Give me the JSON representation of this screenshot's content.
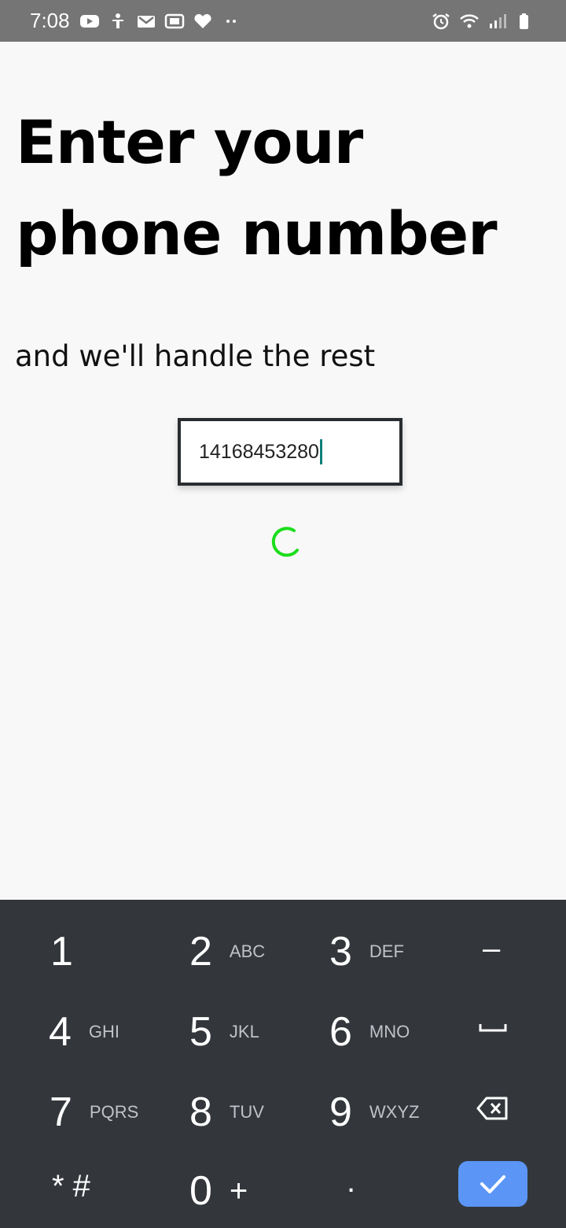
{
  "status_bar": {
    "time": "7:08",
    "left_icons": [
      "youtube-icon",
      "accessibility-icon",
      "gmail-icon",
      "app-icon",
      "heart-icon",
      "more-dots-icon"
    ],
    "right_icons": [
      "alarm-icon",
      "wifi-icon",
      "signal-icon",
      "battery-icon"
    ]
  },
  "main": {
    "title": "Enter your phone number",
    "subtitle": "and we'll handle the rest",
    "phone_input": {
      "value": "14168453280"
    },
    "spinner_color": "#1cdd1c"
  },
  "keyboard": {
    "rows": [
      [
        {
          "digit": "1",
          "letters": ""
        },
        {
          "digit": "2",
          "letters": "ABC"
        },
        {
          "digit": "3",
          "letters": "DEF"
        },
        {
          "symbol": "–"
        }
      ],
      [
        {
          "digit": "4",
          "letters": "GHI"
        },
        {
          "digit": "5",
          "letters": "JKL"
        },
        {
          "digit": "6",
          "letters": "MNO"
        },
        {
          "symbol": "space-icon"
        }
      ],
      [
        {
          "digit": "7",
          "letters": "PQRS"
        },
        {
          "digit": "8",
          "letters": "TUV"
        },
        {
          "digit": "9",
          "letters": "WXYZ"
        },
        {
          "symbol": "backspace-icon"
        }
      ],
      [
        {
          "digit": "* #",
          "letters": ""
        },
        {
          "digit": "0",
          "letters": "+"
        },
        {
          "digit": ".",
          "letters": ""
        },
        {
          "symbol": "check-icon"
        }
      ]
    ],
    "done_color": "#5b96f7"
  }
}
